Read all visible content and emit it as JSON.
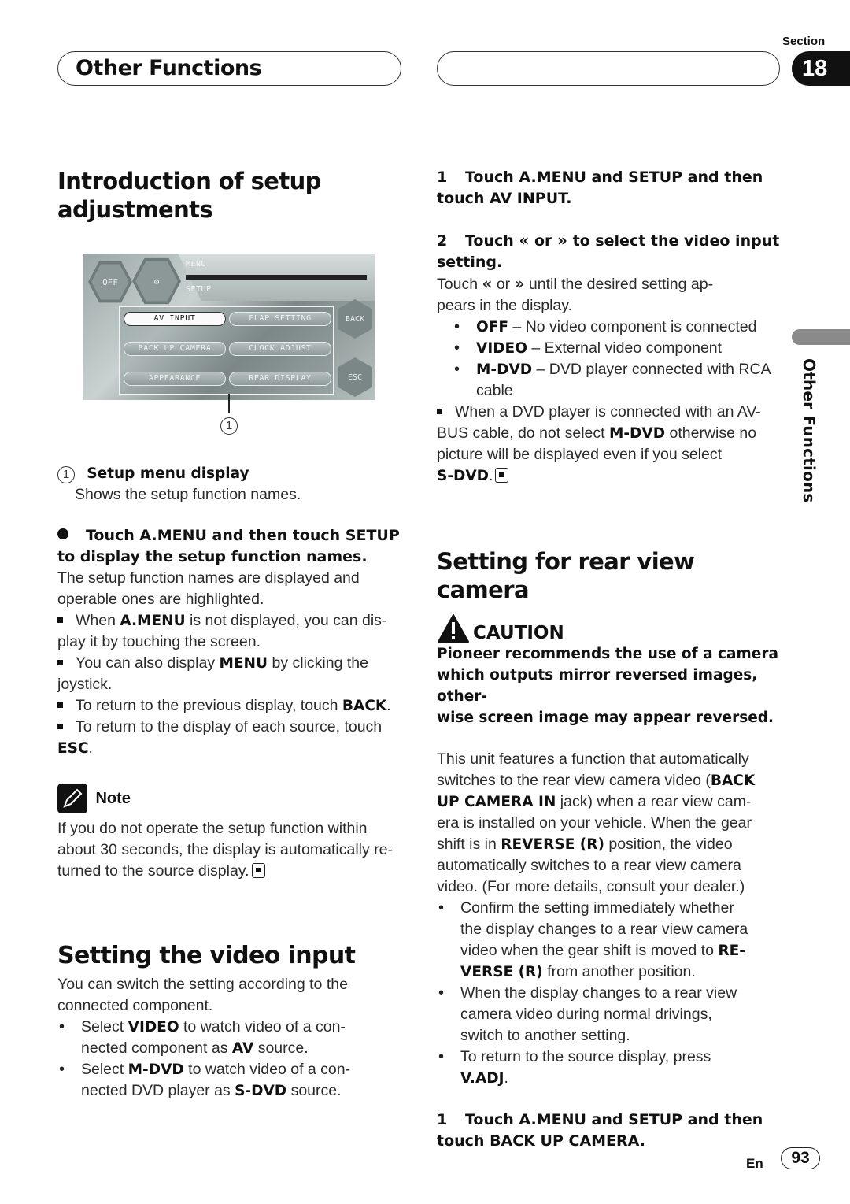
{
  "header": {
    "chapter_title": "Other Functions",
    "section_label": "Section",
    "section_number": "18"
  },
  "side_tab": {
    "label": "Other Functions"
  },
  "left": {
    "intro": {
      "title_line1": "Introduction of setup",
      "title_line2": "adjustments",
      "screen": {
        "menu_label": "MENU",
        "setup_label": "SETUP",
        "off_label": "OFF",
        "buttons": [
          {
            "label": "AV INPUT",
            "active": true
          },
          {
            "label": "FLAP SETTING",
            "active": false
          },
          {
            "label": "BACK UP CAMERA",
            "active": false
          },
          {
            "label": "CLOCK ADJUST",
            "active": false
          },
          {
            "label": "APPEARANCE",
            "active": false
          },
          {
            "label": "REAR DISPLAY",
            "active": false
          }
        ],
        "back_label": "BACK",
        "esc_label": "ESC",
        "callout_number": "1"
      },
      "callout": {
        "number": "1",
        "title": "Setup menu display",
        "desc": "Shows the setup function names."
      },
      "instruction": {
        "line1": "Touch A.MENU and then touch SETUP",
        "line2": "to display the setup function names."
      },
      "para": "The setup function names are displayed and operable ones are highlighted.",
      "notes": [
        {
          "pre": "When ",
          "bold": "A.MENU",
          "post": " is not displayed, you can dis-",
          "cont": "play it by touching the screen."
        },
        {
          "pre": "You can also display ",
          "bold": "MENU",
          "post": " by clicking the",
          "cont": "joystick."
        },
        {
          "pre": "To return to the previous display, touch ",
          "bold": "BACK",
          "post": ".",
          "cont": ""
        },
        {
          "pre": "To return to the display of each source, touch",
          "bold": "ESC",
          "post": ".",
          "cont": ""
        }
      ],
      "note_box": {
        "label": "Note",
        "text": "If you do not operate the setup function within about 30 seconds, the display is automatically re-turned to the source display."
      }
    },
    "video_input": {
      "title": "Setting the video input",
      "para": "You can switch the setting according to the connected component.",
      "bullets": [
        {
          "pre": "Select ",
          "bold1": "VIDEO",
          "mid": " to watch video of a con-",
          "line2_pre": "nected component as ",
          "bold2": "AV",
          "post": " source."
        },
        {
          "pre": "Select ",
          "bold1": "M-DVD",
          "mid": " to watch video of a con-",
          "line2_pre": "nected DVD player as ",
          "bold2": "S-DVD",
          "post": " source."
        }
      ]
    }
  },
  "right": {
    "video_steps": {
      "step1": {
        "num": "1",
        "line1": "Touch A.MENU and SETUP and then",
        "line2": "touch AV INPUT."
      },
      "step2": {
        "num": "2",
        "pre": "Touch",
        "left_glyph": "«",
        "or": "or",
        "right_glyph": "»",
        "post": "to select the video input",
        "line2": "setting."
      },
      "step2_desc": {
        "pre": "Touch",
        "or": "or",
        "post": "until the desired setting ap-",
        "line2": "pears in the display."
      },
      "options": [
        {
          "bold": "OFF",
          "text": " – No video component is connected"
        },
        {
          "bold": "VIDEO",
          "text": " – External video component"
        },
        {
          "bold": "M-DVD",
          "text": " – DVD player connected with RCA",
          "cont": "cable"
        }
      ],
      "warning": {
        "line1": "When a DVD player is connected with an AV-",
        "line2_pre": "BUS cable, do not select ",
        "line2_bold": "M-DVD",
        "line2_post": " otherwise no",
        "line3": "picture will be displayed even if you select",
        "line4_bold": "S-DVD",
        "line4_post": "."
      }
    },
    "rear_camera": {
      "title": "Setting for rear view camera",
      "caution_label": "CAUTION",
      "caution_text": [
        "Pioneer recommends the use of a camera",
        "which outputs mirror reversed images, other-",
        "wise screen image may appear reversed."
      ],
      "para": {
        "l1": "This unit features a function that automatically",
        "l2_pre": "switches to the rear view camera video (",
        "l2_bold": "BACK",
        "l3_bold": "UP CAMERA IN",
        "l3_post": " jack) when a rear view cam-",
        "l4": "era is installed on your vehicle. When the gear",
        "l5_pre": "shift is in ",
        "l5_bold": "REVERSE (R)",
        "l5_post": " position, the video",
        "l6": "automatically switches to a rear view camera",
        "l7": "video. (For more details, consult your dealer.)"
      },
      "bullets": [
        {
          "l1": "Confirm the setting immediately whether",
          "l2": "the display changes to a rear view camera",
          "l3_pre": "video when the gear shift is moved to ",
          "l3_bold": "RE-",
          "l4_bold": "VERSE (R)",
          "l4_post": " from another position."
        },
        {
          "l1": "When the display changes to a rear view",
          "l2": "camera video during normal drivings,",
          "l3": "switch to another setting."
        },
        {
          "l1": "To return to the source display, press",
          "l2_bold": "V.ADJ",
          "l2_post": "."
        }
      ],
      "step1": {
        "num": "1",
        "line1": "Touch A.MENU and SETUP and then",
        "line2": "touch BACK UP CAMERA."
      }
    }
  },
  "footer": {
    "lang": "En",
    "page": "93"
  }
}
